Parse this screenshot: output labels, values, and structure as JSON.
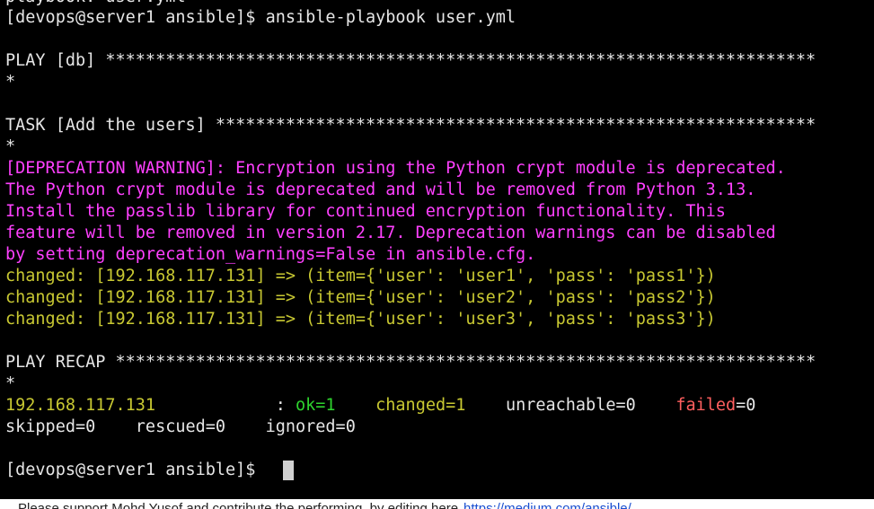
{
  "terminal": {
    "top_clipped": "playbook: user.yml",
    "cmd_line": "[devops@server1 ansible]$ ansible-playbook user.yml",
    "play_header": "PLAY [db] ***********************************************************************",
    "play_header_wrap": "*",
    "task_header": "TASK [Add the users] ************************************************************",
    "task_header_wrap": "*",
    "deprecation": [
      "[DEPRECATION WARNING]: Encryption using the Python crypt module is deprecated.",
      "The Python crypt module is deprecated and will be removed from Python 3.13.",
      "Install the passlib library for continued encryption functionality. This",
      "feature will be removed in version 2.17. Deprecation warnings can be disabled",
      "by setting deprecation_warnings=False in ansible.cfg."
    ],
    "changed": [
      "changed: [192.168.117.131] => (item={'user': 'user1', 'pass': 'pass1'})",
      "changed: [192.168.117.131] => (item={'user': 'user2', 'pass': 'pass2'})",
      "changed: [192.168.117.131] => (item={'user': 'user3', 'pass': 'pass3'})"
    ],
    "recap_header": "PLAY RECAP **********************************************************************",
    "recap_header_wrap": "*",
    "recap": {
      "host": "192.168.117.131",
      "sep": "            : ",
      "ok": "ok=1",
      "gap1": "    ",
      "changed": "changed=1",
      "gap2": "    ",
      "unreachable": "unreachable=0",
      "gap3": "    ",
      "failed_label": "failed",
      "failed_value": "=0",
      "line2": "skipped=0    rescued=0    ignored=0"
    },
    "prompt": "[devops@server1 ansible]$ "
  },
  "footer": {
    "text": "Please support Mohd Yusof and contribute the performing..by editing here",
    "link": "https://medium.com/ansible/..."
  },
  "colors": {
    "background": "#000000",
    "text": "#e6e6e6",
    "warning": "#ff40ff",
    "changed": "#c8c832",
    "ok": "#2ed42e",
    "failed": "#ff5f5f"
  }
}
